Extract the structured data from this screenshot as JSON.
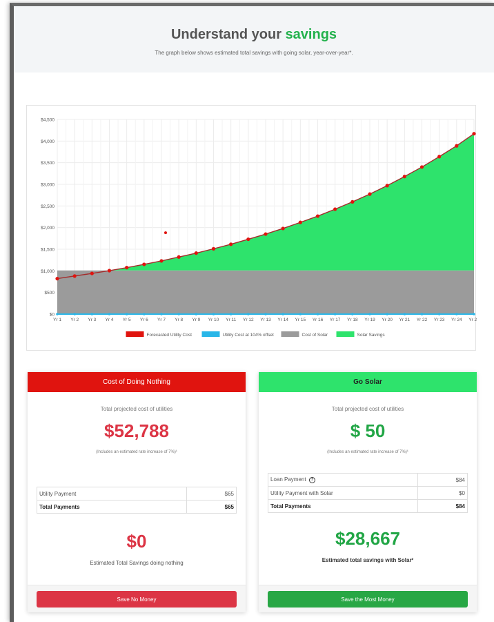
{
  "header": {
    "title_main": "Understand your",
    "title_accent": "savings",
    "subtitle": "The graph below shows estimated total savings with going solar, year-over-year*."
  },
  "colors": {
    "red": "#e0140f",
    "green": "#2ee36c",
    "gray": "#9b9b9b",
    "blue": "#29b6e8",
    "money_red": "#dc3545",
    "money_green": "#22a646"
  },
  "chart_data": {
    "type": "area",
    "categories": [
      "Yr 1",
      "Yr 2",
      "Yr 3",
      "Yr 4",
      "Yr 5",
      "Yr 6",
      "Yr 7",
      "Yr 8",
      "Yr 9",
      "Yr 10",
      "Yr 11",
      "Yr 12",
      "Yr 13",
      "Yr 14",
      "Yr 15",
      "Yr 16",
      "Yr 17",
      "Yr 18",
      "Yr 19",
      "Yr 20",
      "Yr 21",
      "Yr 22",
      "Yr 23",
      "Yr 24",
      "Yr 25"
    ],
    "ylim": [
      0,
      4500
    ],
    "y_ticks": [
      "$0",
      "$500",
      "$1,000",
      "$1,500",
      "$2,000",
      "$2,500",
      "$3,000",
      "$3,500",
      "$4,000",
      "$4,500"
    ],
    "grid": true,
    "legend_position": "bottom",
    "series": [
      {
        "name": "Forecasted Utility Cost",
        "color": "#e0140f",
        "values": [
          820,
          880,
          940,
          1005,
          1075,
          1150,
          1230,
          1320,
          1410,
          1510,
          1615,
          1730,
          1850,
          1980,
          2120,
          2265,
          2425,
          2595,
          2775,
          2970,
          3180,
          3400,
          3640,
          3890,
          4170
        ]
      },
      {
        "name": "Utility Cost at 104% offset",
        "color": "#29b6e8",
        "values": [
          0,
          0,
          0,
          0,
          0,
          0,
          0,
          0,
          0,
          0,
          0,
          0,
          0,
          0,
          0,
          0,
          0,
          0,
          0,
          0,
          0,
          0,
          0,
          0,
          0
        ]
      },
      {
        "name": "Cost of Solar",
        "color": "#9b9b9b",
        "values": [
          1010,
          1010,
          1010,
          1010,
          1010,
          1010,
          1010,
          1010,
          1010,
          1010,
          1010,
          1010,
          1010,
          1010,
          1010,
          1010,
          1010,
          1010,
          1010,
          1010,
          1010,
          1010,
          1010,
          1010,
          1010
        ]
      },
      {
        "name": "Solar Savings",
        "color": "#2ee36c",
        "values": [
          0,
          0,
          0,
          0,
          65,
          140,
          220,
          310,
          400,
          500,
          605,
          720,
          840,
          970,
          1110,
          1255,
          1415,
          1585,
          1765,
          1960,
          2170,
          2390,
          2630,
          2880,
          3160
        ]
      }
    ],
    "stray_point": {
      "x": "Yr 7",
      "y": 1880
    }
  },
  "left_card": {
    "header": "Cost of Doing Nothing",
    "projected_label": "Total projected cost of utilities",
    "amount": "$52,788",
    "note": "(Includes an estimated rate increase of 7%)¹",
    "rows": [
      {
        "label": "Utility Payment",
        "value": "$65"
      }
    ],
    "total_label": "Total Payments",
    "total_value": "$65",
    "savings_amount": "$0",
    "savings_label": "Estimated Total Savings doing nothing",
    "button": "Save No Money"
  },
  "right_card": {
    "header": "Go Solar",
    "projected_label": "Total projected cost of utilities",
    "amount": "$ 50",
    "note": "(Includes an estimated rate increase of 7%)¹",
    "rows": [
      {
        "label": "Loan Payment",
        "value": "$84",
        "icon": "question-circle-icon"
      },
      {
        "label": "Utility Payment with Solar",
        "value": "$0"
      }
    ],
    "total_label": "Total Payments",
    "total_value": "$84",
    "savings_amount": "$28,667",
    "savings_label": "Estimated total savings with Solar²",
    "button": "Save the Most Money"
  }
}
